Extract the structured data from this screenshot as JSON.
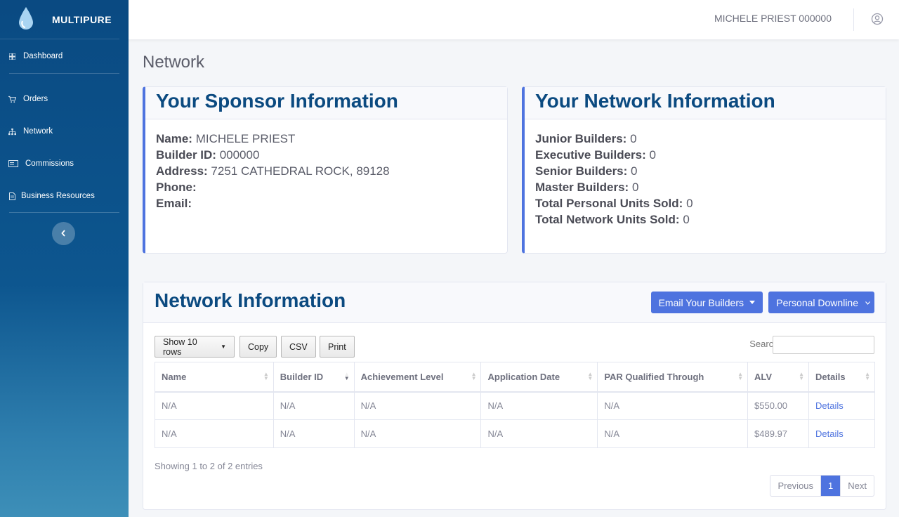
{
  "brand": {
    "name": "MULTIPURE"
  },
  "sidebar": {
    "items": [
      {
        "label": "Dashboard",
        "icon": "dashboard-icon"
      },
      {
        "label": "Orders",
        "icon": "cart-icon"
      },
      {
        "label": "Network",
        "icon": "sitemap-icon"
      },
      {
        "label": "Commissions",
        "icon": "money-icon"
      },
      {
        "label": "Business Resources",
        "icon": "document-icon"
      }
    ]
  },
  "topbar": {
    "user_name": "MICHELE PRIEST 000000"
  },
  "page": {
    "title": "Network"
  },
  "sponsor": {
    "title": "Your Sponsor Information",
    "name_label": "Name:",
    "name_value": "MICHELE PRIEST",
    "builder_label": "Builder ID:",
    "builder_value": "000000",
    "address_label": "Address:",
    "address_value": "7251 CATHEDRAL ROCK, 89128",
    "phone_label": "Phone:",
    "phone_value": "",
    "email_label": "Email:",
    "email_value": ""
  },
  "network_info": {
    "title": "Your Network Information",
    "rows": [
      {
        "label": "Junior Builders:",
        "value": "0"
      },
      {
        "label": "Executive Builders:",
        "value": "0"
      },
      {
        "label": "Senior Builders:",
        "value": "0"
      },
      {
        "label": "Master Builders:",
        "value": "0"
      },
      {
        "label": "Total Personal Units Sold:",
        "value": "0"
      },
      {
        "label": "Total Network Units Sold:",
        "value": "0"
      }
    ]
  },
  "table_card": {
    "title": "Network Information",
    "email_button": "Email Your Builders",
    "downline_button": "Personal Downline",
    "show_rows": "Show 10 rows",
    "copy": "Copy",
    "csv": "CSV",
    "print": "Print",
    "search_label": "Search:",
    "columns": [
      "Name",
      "Builder ID",
      "Achievement Level",
      "Application Date",
      "PAR Qualified Through",
      "ALV",
      "Details"
    ],
    "rows": [
      [
        "N/A",
        "N/A",
        "N/A",
        "N/A",
        "N/A",
        "$550.00",
        "Details"
      ],
      [
        "N/A",
        "N/A",
        "N/A",
        "N/A",
        "N/A",
        "$489.97",
        "Details"
      ]
    ],
    "entries": "Showing 1 to 2 of 2 entries",
    "pager": {
      "previous": "Previous",
      "current": "1",
      "next": "Next"
    }
  },
  "colors": {
    "primary": "#4e73df",
    "heading": "#0b4a80",
    "sidebar": "#0a4a82"
  }
}
